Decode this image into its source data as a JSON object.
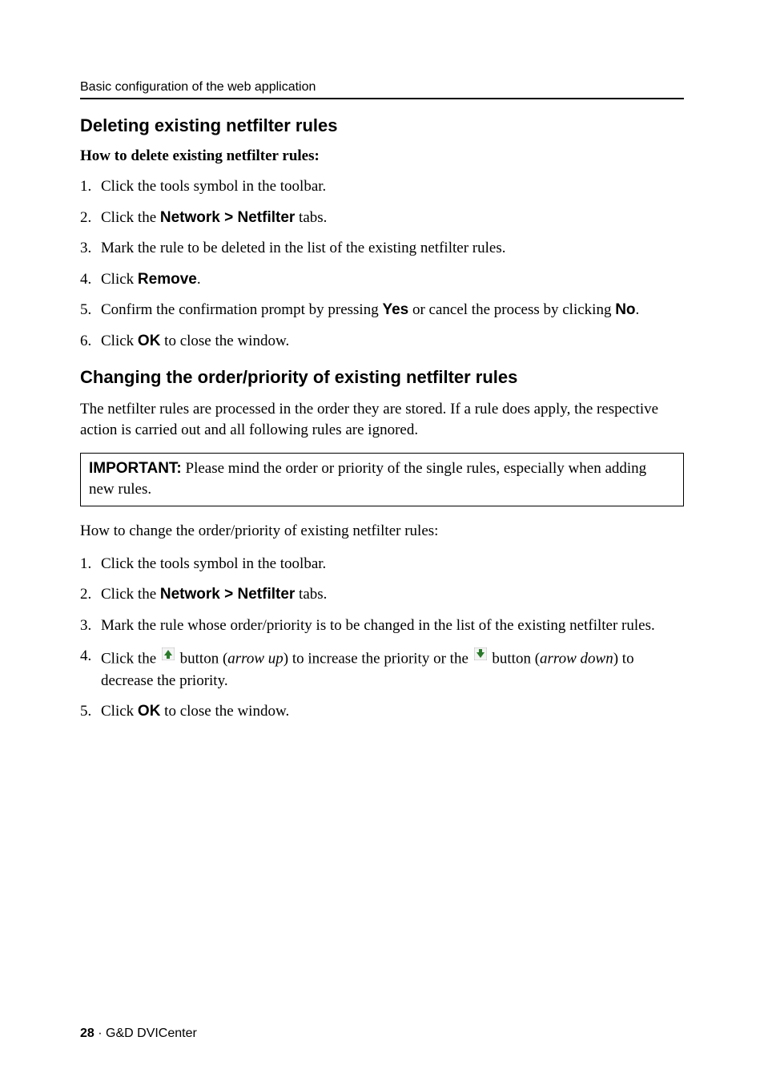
{
  "runningHead": "Basic configuration of the web application",
  "section1": {
    "heading": "Deleting existing netfilter rules",
    "subheading": "How to delete existing netfilter rules:",
    "steps": {
      "s1": "Click the tools symbol in the toolbar.",
      "s2_pre": "Click the ",
      "s2_bold": "Network > Netfilter",
      "s2_post": " tabs.",
      "s3": "Mark the rule to be deleted in the list of the existing netfilter rules.",
      "s4_pre": "Click ",
      "s4_bold": "Remove",
      "s4_post": ".",
      "s5_pre": "Confirm the confirmation prompt by pressing ",
      "s5_b1": "Yes",
      "s5_mid": " or cancel the process by clicking ",
      "s5_b2": "No",
      "s5_post": ".",
      "s6_pre": "Click ",
      "s6_bold": "OK",
      "s6_post": " to close the window."
    }
  },
  "section2": {
    "heading": "Changing the order/priority of existing netfilter rules",
    "intro": "The netfilter rules are processed in the order they are stored. If a rule does apply, the respective action is carried out and all following rules are ignored.",
    "note_label": "IMPORTANT:",
    "note_body": " Please mind the order or priority of the single rules, especially when adding new rules.",
    "howto": "How to change the order/priority of existing netfilter rules:",
    "steps": {
      "s1": "Click the tools symbol in the toolbar.",
      "s2_pre": "Click the ",
      "s2_bold": "Network > Netfilter",
      "s2_post": " tabs.",
      "s3": "Mark the rule whose order/priority is to be changed in the list of the existing netfilter rules.",
      "s4_pre": "Click the ",
      "s4_mid1": " button (",
      "s4_it1": "arrow up",
      "s4_mid2": ") to increase the priority or the ",
      "s4_mid3": " button (",
      "s4_it2": "arrow down",
      "s4_post": ") to decrease the priority.",
      "s5_pre": "Click ",
      "s5_bold": "OK",
      "s5_post": " to close the window."
    }
  },
  "footer": {
    "page": "28",
    "sep": " · ",
    "product": "G&D DVICenter"
  }
}
